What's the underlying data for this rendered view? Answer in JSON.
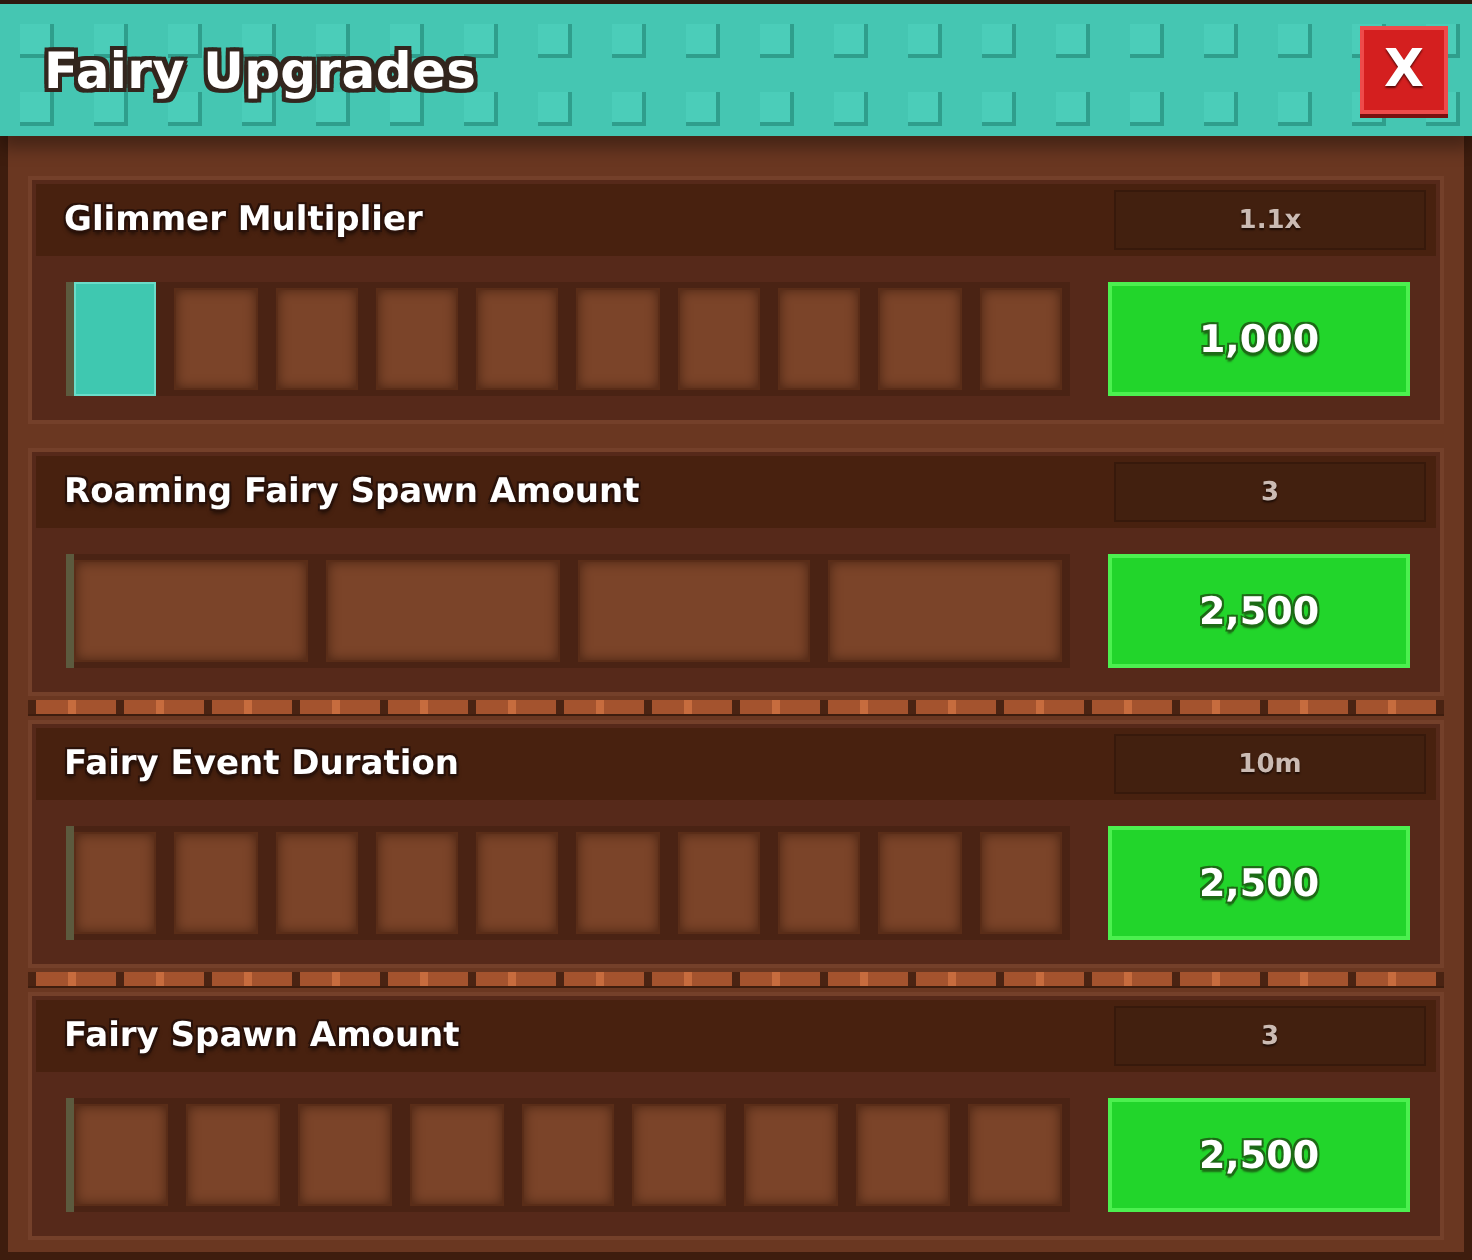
{
  "window": {
    "title": "Fairy Upgrades",
    "close_label": "X"
  },
  "upgrades": [
    {
      "name": "Glimmer Multiplier",
      "value": "1.1x",
      "segments": [
        {
          "filled": true
        },
        {
          "filled": false
        },
        {
          "filled": false
        },
        {
          "filled": false
        },
        {
          "filled": false
        },
        {
          "filled": false
        },
        {
          "filled": false
        },
        {
          "filled": false
        },
        {
          "filled": false
        },
        {
          "filled": false
        }
      ],
      "price": "1,000"
    },
    {
      "name": "Roaming Fairy Spawn Amount",
      "value": "3",
      "segments": [
        {
          "filled": false
        },
        {
          "filled": false
        },
        {
          "filled": false
        },
        {
          "filled": false
        }
      ],
      "price": "2,500"
    },
    {
      "name": "Fairy Event Duration",
      "value": "10m",
      "segments": [
        {
          "filled": false
        },
        {
          "filled": false
        },
        {
          "filled": false
        },
        {
          "filled": false
        },
        {
          "filled": false
        },
        {
          "filled": false
        },
        {
          "filled": false
        },
        {
          "filled": false
        },
        {
          "filled": false
        },
        {
          "filled": false
        }
      ],
      "price": "2,500"
    },
    {
      "name": "Fairy Spawn Amount",
      "value": "3",
      "segments": [
        {
          "filled": false
        },
        {
          "filled": false
        },
        {
          "filled": false
        },
        {
          "filled": false
        },
        {
          "filled": false
        },
        {
          "filled": false
        },
        {
          "filled": false
        },
        {
          "filled": false
        },
        {
          "filled": false
        }
      ],
      "price": "2,500"
    }
  ]
}
